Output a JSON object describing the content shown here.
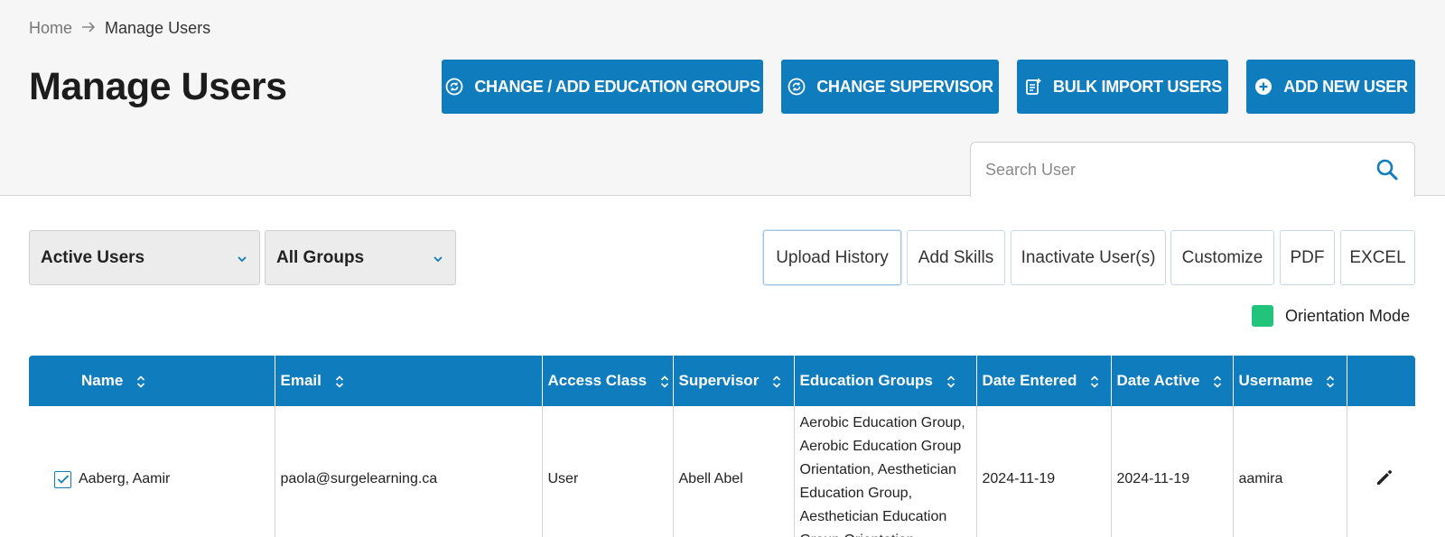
{
  "breadcrumb": {
    "home": "Home",
    "current": "Manage Users"
  },
  "page_title": "Manage Users",
  "actions": {
    "edu_groups": "CHANGE / ADD EDUCATION GROUPS",
    "supervisor": "CHANGE SUPERVISOR",
    "bulk_import": "BULK IMPORT USERS",
    "add_user": "ADD NEW USER"
  },
  "search": {
    "placeholder": "Search User",
    "value": ""
  },
  "filters": {
    "status": "Active Users",
    "group": "All Groups"
  },
  "toolbar": {
    "upload_history": "Upload History",
    "add_skills": "Add Skills",
    "inactivate": "Inactivate User(s)",
    "customize": "Customize",
    "pdf": "PDF",
    "excel": "EXCEL"
  },
  "orientation": {
    "label": "Orientation Mode",
    "color": "#22c37a"
  },
  "table": {
    "headers": {
      "name": "Name",
      "email": "Email",
      "access_class": "Access Class",
      "supervisor": "Supervisor",
      "education_groups": "Education Groups",
      "date_entered": "Date Entered",
      "date_active": "Date Active",
      "username": "Username"
    },
    "rows": [
      {
        "checked": true,
        "name": "Aaberg, Aamir",
        "email": "paola@surgelearning.ca",
        "access_class": "User",
        "supervisor": "Abell Abel",
        "education_groups": "Aerobic Education Group, Aerobic Education Group Orientation, Aesthetician Education Group, Aesthetician Education Group Orientation,",
        "date_entered": "2024-11-19",
        "date_active": "2024-11-19",
        "username": "aamira"
      }
    ]
  },
  "colors": {
    "primary": "#0f7dbd",
    "header_bg": "#f6f6f6"
  }
}
